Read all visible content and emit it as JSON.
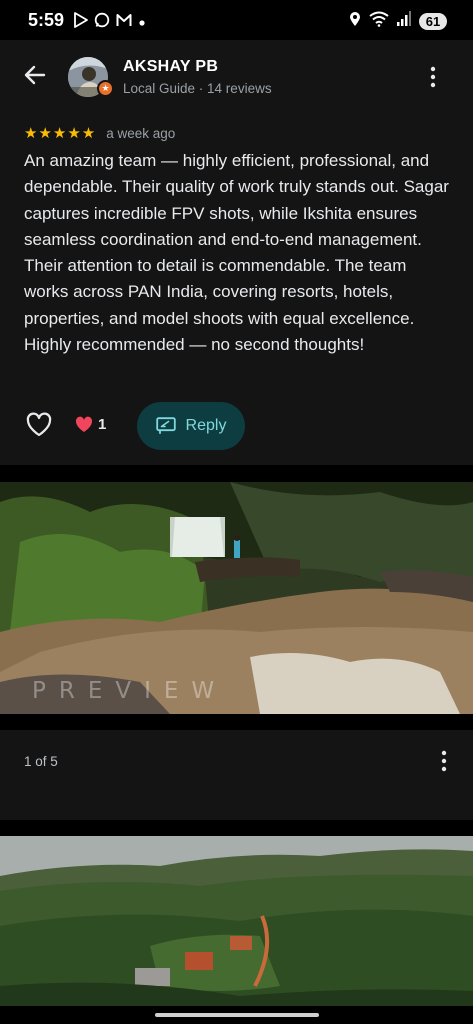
{
  "status_bar": {
    "time": "5:59",
    "left_icons": [
      "play-store-icon",
      "whatsapp-icon",
      "gmail-icon",
      "dot-icon"
    ],
    "right_icons": [
      "location-icon",
      "wifi-icon",
      "signal-icon"
    ],
    "battery": "61"
  },
  "review": {
    "reviewer_name": "AKSHAY PB",
    "reviewer_meta": "Local Guide · 14 reviews",
    "rating_stars": 5,
    "stars_text": "★★★★★",
    "date": "a week ago",
    "text": "An amazing team — highly efficient, professional, and dependable. Their quality of work truly stands out. Sagar captures incredible FPV shots, while Ikshita ensures seamless coordination and end-to-end management. Their attention to detail is commendable. The team works across PAN India, covering resorts, hotels, properties, and model shoots with equal excellence. Highly recommended — no second thoughts!",
    "likes_count": "1",
    "reply_label": "Reply"
  },
  "photos": {
    "watermark": "PREVIEW",
    "counter": "1 of 5"
  },
  "colors": {
    "background": "#000000",
    "card": "#141414",
    "star": "#fbbc04",
    "reply_bg": "#0d3d40",
    "reply_text": "#7fd8de",
    "heart": "#f0455d",
    "badge": "#e8702a"
  }
}
